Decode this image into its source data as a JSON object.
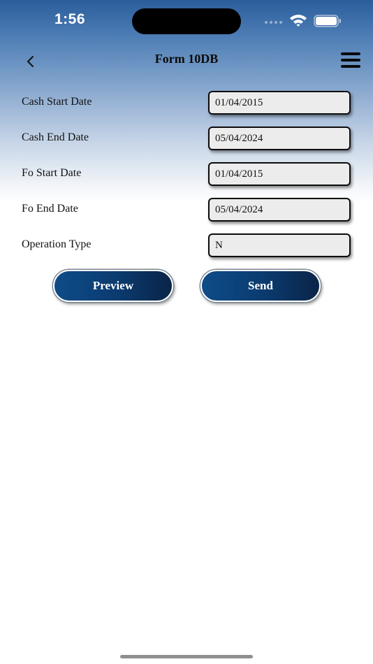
{
  "status_bar": {
    "time": "1:56"
  },
  "header": {
    "title": "Form 10DB",
    "back_icon": "chevron-left-icon",
    "menu_icon": "hamburger-menu-icon"
  },
  "form": {
    "fields": [
      {
        "label": "Cash Start Date",
        "value": "01/04/2015"
      },
      {
        "label": "Cash End Date",
        "value": "05/04/2024"
      },
      {
        "label": "Fo Start Date",
        "value": "01/04/2015"
      },
      {
        "label": "Fo End Date",
        "value": "05/04/2024"
      },
      {
        "label": "Operation Type",
        "value": "N"
      }
    ]
  },
  "actions": {
    "preview_label": "Preview",
    "send_label": "Send"
  },
  "colors": {
    "header_gradient_top": "#2a5d9b",
    "button_gradient_start": "#0e4c89",
    "button_gradient_end": "#0a2447",
    "input_background": "#ececec"
  }
}
